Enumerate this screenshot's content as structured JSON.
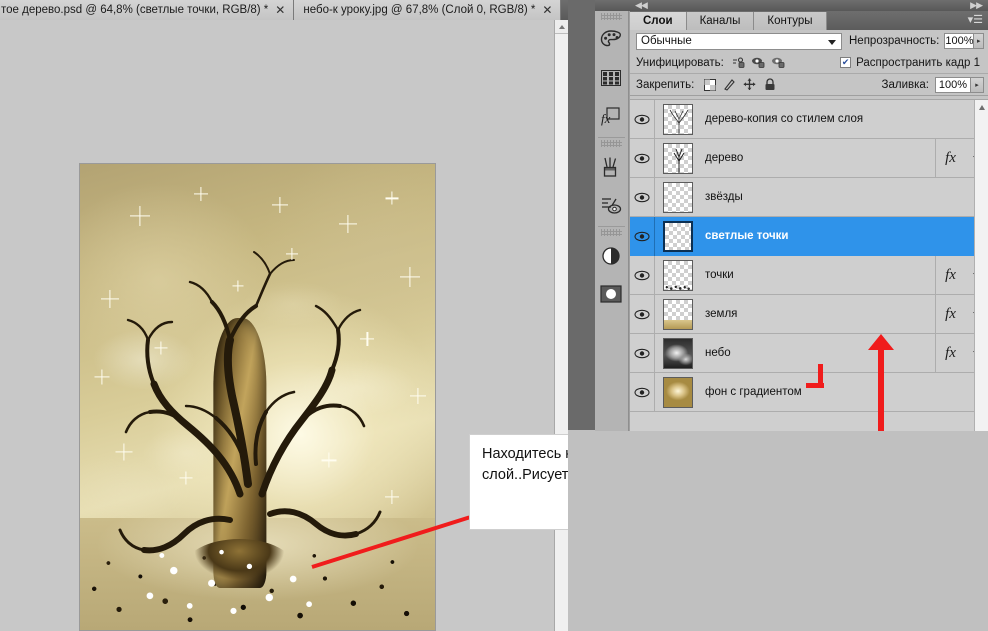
{
  "document_tabs": [
    {
      "label": "тое дерево.psd @ 64,8% (светлые точки, RGB/8) *",
      "close": "✕",
      "active": true
    },
    {
      "label": "небо-к уроку.jpg @ 67,8% (Слой 0, RGB/8) *",
      "close": "✕",
      "active": false
    }
  ],
  "panel": {
    "tabs": [
      {
        "label": "Слои",
        "active": true
      },
      {
        "label": "Каналы",
        "active": false
      },
      {
        "label": "Контуры",
        "active": false
      }
    ],
    "menu_icon": "panel-menu-icon",
    "blend_mode": "Обычные",
    "opacity_label": "Непрозрачность:",
    "opacity_value": "100%",
    "unify_label": "Унифицировать:",
    "unify_icons": [
      "unify-position-icon",
      "unify-visibility-icon",
      "unify-style-icon"
    ],
    "propagate_label": "Распространить кадр 1",
    "propagate_checked": true,
    "lock_label": "Закрепить:",
    "lock_icons": [
      "lock-transparency-icon",
      "lock-image-icon",
      "lock-position-icon",
      "lock-all-icon"
    ],
    "fill_label": "Заливка:",
    "fill_value": "100%",
    "spinner_glyph": "▸"
  },
  "layers": [
    {
      "name": "дерево-копия со стилем слоя",
      "visible": true,
      "has_fx": false,
      "selected": false,
      "thumb": "tree"
    },
    {
      "name": "дерево",
      "visible": true,
      "has_fx": true,
      "selected": false,
      "thumb": "tree"
    },
    {
      "name": "звёзды",
      "visible": true,
      "has_fx": false,
      "selected": false,
      "thumb": "empty"
    },
    {
      "name": "светлые точки",
      "visible": true,
      "has_fx": false,
      "selected": true,
      "thumb": "empty"
    },
    {
      "name": "точки",
      "visible": true,
      "has_fx": true,
      "selected": false,
      "thumb": "dots"
    },
    {
      "name": "земля",
      "visible": true,
      "has_fx": true,
      "selected": false,
      "thumb": "ground"
    },
    {
      "name": "небо",
      "visible": true,
      "has_fx": true,
      "selected": false,
      "thumb": "sky"
    },
    {
      "name": "фон с градиентом",
      "visible": true,
      "has_fx": false,
      "selected": false,
      "thumb": "gradient"
    }
  ],
  "layer_fx_glyph": "fx",
  "eye_glyph": "eye-icon",
  "annotation": {
    "text": "Находитесь на слое ТОЧКИ(золотые) и создаёте новый слой..Рисуете у корней дерева россыпь светлых точек",
    "arrow_color": "#f01c1c",
    "pointer_color": "#f01c1c"
  },
  "icon_rail": [
    "color-palette-icon",
    "swatches-grid-icon",
    "styles-fx-icon",
    "brushes-icon",
    "tool-presets-icon",
    "adjustments-icon",
    "masks-icon"
  ],
  "colors": {
    "selection_blue": "#2f93ea",
    "panel_bg": "#c5c5c5",
    "list_bg": "#cfcfcf",
    "chrome_dark": "#6a6a6a",
    "annotation_red": "#f01c1c"
  }
}
